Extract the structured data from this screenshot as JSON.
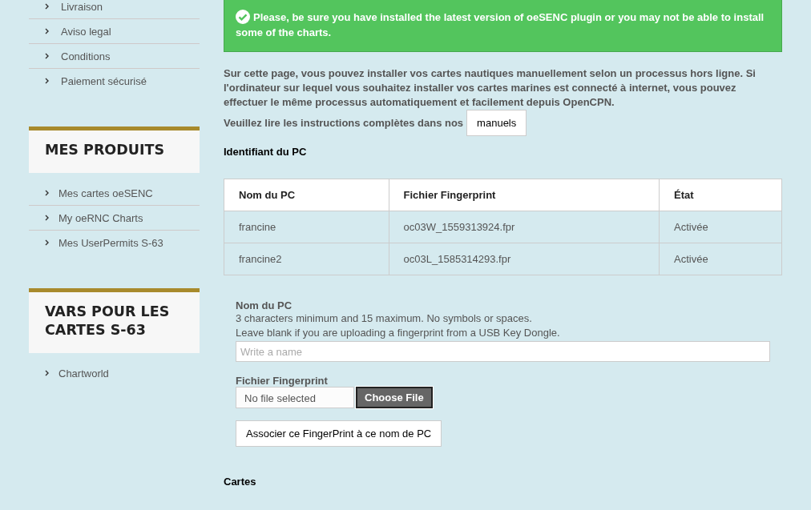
{
  "sidebar": {
    "top_links": [
      "Livraison",
      "Aviso legal",
      "Conditions",
      "Paiement sécurisé"
    ],
    "sections": [
      {
        "title": "MES PRODUITS",
        "links": [
          "Mes cartes oeSENC",
          "My oeRNC Charts",
          "Mes UserPermits S-63"
        ]
      },
      {
        "title": "VARS POUR LES CARTES S-63",
        "links": [
          "Chartworld"
        ]
      }
    ]
  },
  "alert": {
    "text": "Please, be sure you have installed the latest version of oeSENC plugin or you may not be able to install some of the charts."
  },
  "intro": "Sur cette page, vous pouvez installer vos cartes nautiques manuellement selon un processus hors ligne. Si l'ordinateur sur lequel vous souhaitez installer vos cartes marines est connecté à internet, vous pouvez effectuer le même processus automatiquement et facilement depuis OpenCPN.",
  "manuals": {
    "text": "Veuillez lire les instructions complètes dans nos",
    "button": "manuels"
  },
  "pc_heading": "Identifiant du PC",
  "table": {
    "columns": [
      "Nom du PC",
      "Fichier Fingerprint",
      "État"
    ],
    "rows": [
      [
        "francine",
        "oc03W_1559313924.fpr",
        "Activée"
      ],
      [
        "francine2",
        "oc03L_1585314293.fpr",
        "Activée"
      ]
    ]
  },
  "form": {
    "name_label": "Nom du PC",
    "hints": [
      "3 characters minimum and 15 maximum. No symbols or spaces.",
      "Leave blank if you are uploading a fingerprint from a USB Key Dongle."
    ],
    "name_placeholder": "Write a name",
    "file_label": "Fichier Fingerprint",
    "file_status": "No file selected",
    "choose_button": "Choose File",
    "submit_button": "Associer ce FingerPrint à ce nom de PC"
  },
  "cards_heading": "Cartes"
}
